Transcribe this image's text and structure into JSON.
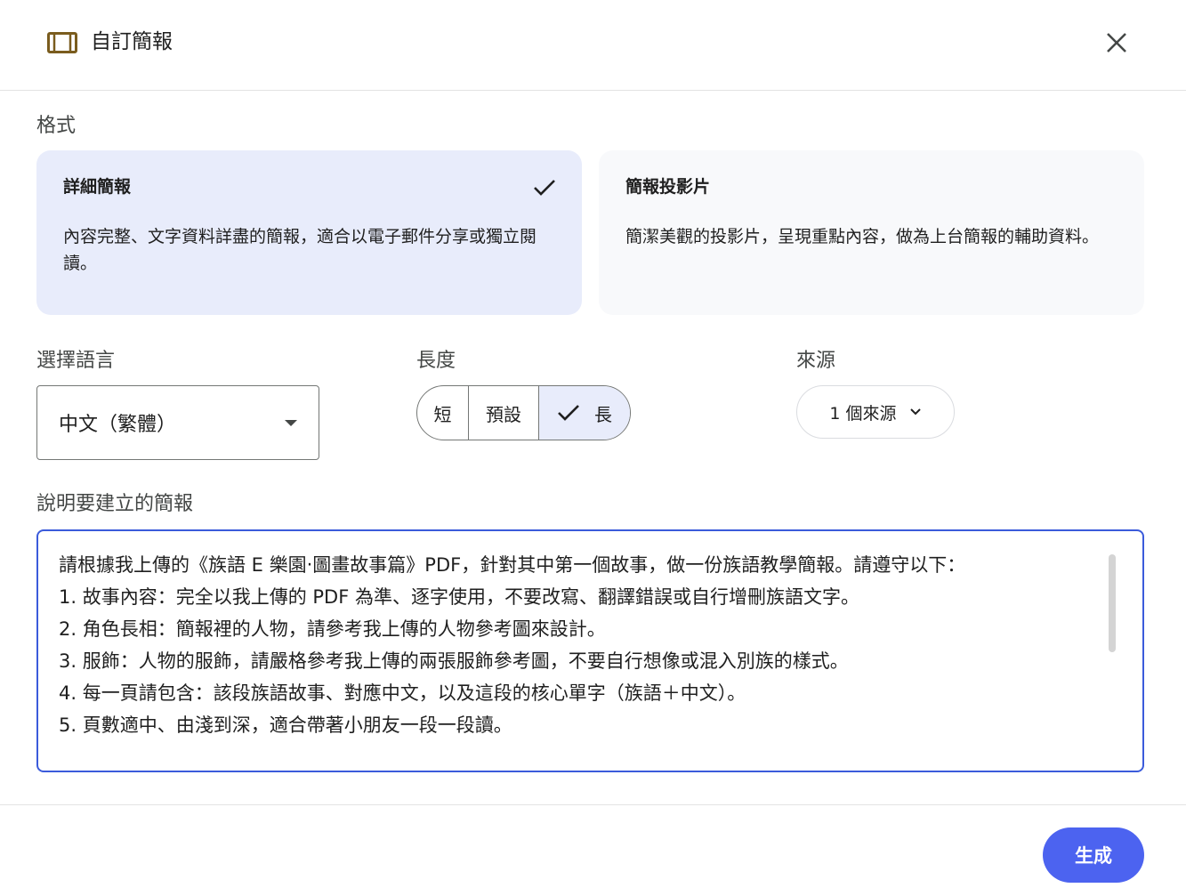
{
  "dialog": {
    "title": "自訂簡報"
  },
  "format": {
    "label": "格式",
    "options": [
      {
        "title": "詳細簡報",
        "description": "內容完整、文字資料詳盡的簡報，適合以電子郵件分享或獨立閱讀。",
        "selected": true
      },
      {
        "title": "簡報投影片",
        "description": "簡潔美觀的投影片，呈現重點內容，做為上台簡報的輔助資料。",
        "selected": false
      }
    ]
  },
  "language": {
    "label": "選擇語言",
    "value": "中文（繁體）"
  },
  "length": {
    "label": "長度",
    "options": [
      "短",
      "預設",
      "長"
    ],
    "selected": "長"
  },
  "source": {
    "label": "來源",
    "value": "1 個來源"
  },
  "description": {
    "label": "說明要建立的簡報",
    "text": "請根據我上傳的《族語 E 樂園‧圖畫故事篇》PDF，針對其中第一個故事，做一份族語教學簡報。請遵守以下：\n1. 故事內容：完全以我上傳的 PDF 為準、逐字使用，不要改寫、翻譯錯誤或自行增刪族語文字。\n2. 角色長相：簡報裡的人物，請參考我上傳的人物參考圖來設計。\n3. 服飾：人物的服飾，請嚴格參考我上傳的兩張服飾參考圖，不要自行想像或混入別族的樣式。\n4. 每一頁請包含：該段族語故事、對應中文，以及這段的核心單字（族語＋中文）。\n5. 頁數適中、由淺到深，適合帶著小朋友一段一段讀。"
  },
  "footer": {
    "generate_label": "生成"
  },
  "colors": {
    "accent": "#4c63f0",
    "selected_bg": "#e8ecfb",
    "focus_border": "#3b5bdb"
  }
}
